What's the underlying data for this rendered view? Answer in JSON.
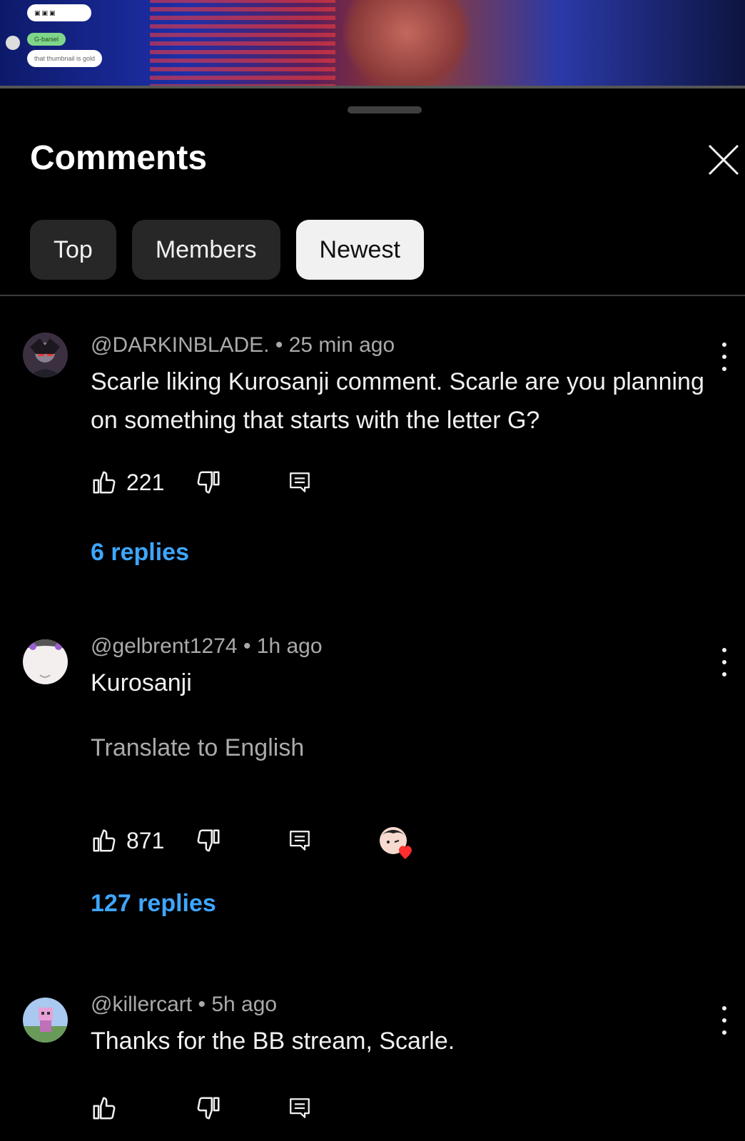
{
  "video": {
    "chat_lines": [
      "G-baniel",
      "that thumbnail is gold"
    ]
  },
  "sheet": {
    "title": "Comments",
    "close_icon": "close-icon"
  },
  "sort_chips": [
    {
      "label": "Top",
      "active": false
    },
    {
      "label": "Members",
      "active": false
    },
    {
      "label": "Newest",
      "active": true
    }
  ],
  "comments": [
    {
      "author": "@DARKINBLADE.",
      "time": "25 min ago",
      "text": "Scarle liking Kurosanji comment. Scarle are you planning on something that starts with the letter G?",
      "likes": "221",
      "replies": "6 replies"
    },
    {
      "author": "@gelbrent1274",
      "time": "1h ago",
      "text": "Kurosanji",
      "translate": "Translate to English",
      "likes": "871",
      "replies": "127 replies",
      "creator_heart": true
    },
    {
      "author": "@killercart",
      "time": "5h ago",
      "text": "Thanks for the BB stream, Scarle.",
      "likes": ""
    }
  ],
  "colors": {
    "background": "#000000",
    "chip_bg": "#272727",
    "chip_active_bg": "#f1f1f1",
    "link_blue": "#3ea6ff",
    "secondary_text": "#aaaaaa",
    "heart_red": "#ff2d2d"
  }
}
